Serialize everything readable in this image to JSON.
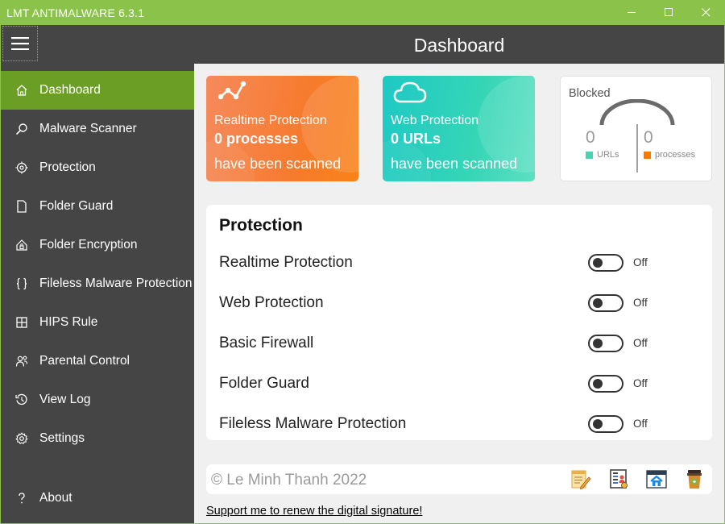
{
  "window": {
    "title": "LMT ANTIMALWARE 6.3.1",
    "controls": {
      "minimize": "minimize-icon",
      "maximize": "maximize-icon",
      "close": "close-icon"
    }
  },
  "header": {
    "title": "Dashboard",
    "menu_icon": "hamburger-menu-icon"
  },
  "sidebar": {
    "items": [
      {
        "label": "Dashboard",
        "icon": "home-icon",
        "active": true
      },
      {
        "label": "Malware Scanner",
        "icon": "search-icon"
      },
      {
        "label": "Protection",
        "icon": "radar-icon"
      },
      {
        "label": "Folder Guard",
        "icon": "document-icon"
      },
      {
        "label": "Folder Encryption",
        "icon": "lock-folder-icon"
      },
      {
        "label": "Fileless Malware Protection",
        "icon": "braces-icon"
      },
      {
        "label": "HIPS Rule",
        "icon": "grid-icon"
      },
      {
        "label": "Parental Control",
        "icon": "people-icon"
      },
      {
        "label": "View Log",
        "icon": "history-icon"
      },
      {
        "label": "Settings",
        "icon": "gear-icon"
      }
    ],
    "about": {
      "label": "About",
      "icon": "question-icon"
    },
    "accent": "#6a9e24"
  },
  "cards": {
    "realtime": {
      "line1": "Realtime Protection",
      "line2": "0 processes",
      "line3": "have been scanned",
      "icon": "network-nodes-icon",
      "color": "#f67b2e"
    },
    "web": {
      "line1": "Web Protection",
      "line2": "0 URLs",
      "line3": "have been scanned",
      "icon": "cloud-icon",
      "color": "#26ccbe"
    },
    "blocked": {
      "title": "Blocked",
      "urls_count": "0",
      "urls_label": "URLs",
      "urls_color": "#4dd0b0",
      "processes_count": "0",
      "processes_label": "processes",
      "processes_color": "#f57c00"
    }
  },
  "protection": {
    "title": "Protection",
    "items": [
      {
        "label": "Realtime Protection",
        "state": "Off"
      },
      {
        "label": "Web Protection",
        "state": "Off"
      },
      {
        "label": "Basic Firewall",
        "state": "Off"
      },
      {
        "label": "Folder Guard",
        "state": "Off"
      },
      {
        "label": "Fileless Malware Protection",
        "state": "Off"
      }
    ]
  },
  "footer": {
    "copyright": "© Le Minh Thanh 2022",
    "icons": [
      "notepad-icon",
      "contact-card-icon",
      "home-window-icon",
      "coffee-cup-icon"
    ],
    "support_link": "Support me to renew the digital signature!"
  }
}
